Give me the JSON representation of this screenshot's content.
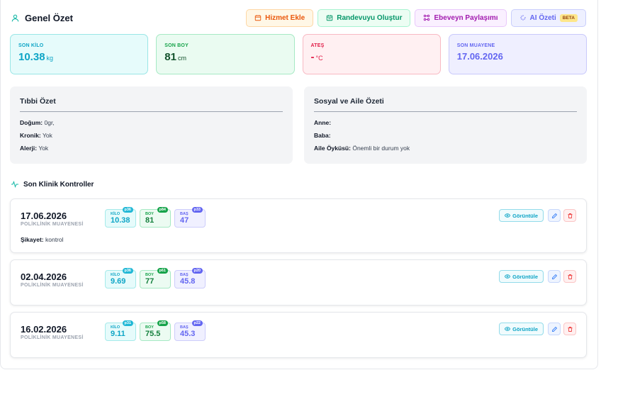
{
  "header": {
    "title": "Genel Özet",
    "buttons": {
      "add_service": "Hizmet Ekle",
      "create_appointment": "Randevuyu Oluştur",
      "parent_share": "Ebeveyn Paylaşımı",
      "ai_summary": "AI Özeti",
      "beta": "BETA"
    }
  },
  "stats": {
    "weight": {
      "label": "SON KİLO",
      "value": "10.38",
      "unit": "kg"
    },
    "height": {
      "label": "SON BOY",
      "value": "81",
      "unit": "cm"
    },
    "fever": {
      "label": "ATEŞ",
      "value": "-",
      "unit": "°C"
    },
    "last_exam": {
      "label": "SON MUAYENE",
      "value": "17.06.2026"
    }
  },
  "medical": {
    "title": "Tıbbi Özet",
    "rows": [
      {
        "label": "Doğum:",
        "value": "0gr,"
      },
      {
        "label": "Kronik:",
        "value": "Yok"
      },
      {
        "label": "Alerji:",
        "value": "Yok"
      }
    ]
  },
  "social": {
    "title": "Sosyal ve Aile Özeti",
    "rows": [
      {
        "label": "Anne:",
        "value": ""
      },
      {
        "label": "Baba:",
        "value": ""
      },
      {
        "label": "Aile Öyküsü:",
        "value": "Önemli bir durum yok"
      }
    ]
  },
  "visits_section": {
    "title": "Son Klinik Kontroller"
  },
  "metric_labels": {
    "weight": "KİLO",
    "height": "BOY",
    "head": "BAŞ"
  },
  "visit_actions": {
    "view": "Görüntüle"
  },
  "visits": [
    {
      "date": "17.06.2026",
      "type": "POLİKLİNİK MUAYENESİ",
      "weight": "10.38",
      "weight_pct": "p36",
      "height": "81",
      "height_pct": "p84",
      "head": "47",
      "head_pct": "p33",
      "complaint_label": "Şikayet:",
      "complaint": "kontrol"
    },
    {
      "date": "02.04.2026",
      "type": "POLİKLİNİK MUAYENESİ",
      "weight": "9.69",
      "weight_pct": "p36",
      "height": "77",
      "height_pct": "p61",
      "head": "45.8",
      "head_pct": "p20"
    },
    {
      "date": "16.02.2026",
      "type": "POLİKLİNİK MUAYENESİ",
      "weight": "9.11",
      "weight_pct": "p31",
      "height": "75.5",
      "height_pct": "p58",
      "head": "45.3",
      "head_pct": "p22"
    }
  ]
}
